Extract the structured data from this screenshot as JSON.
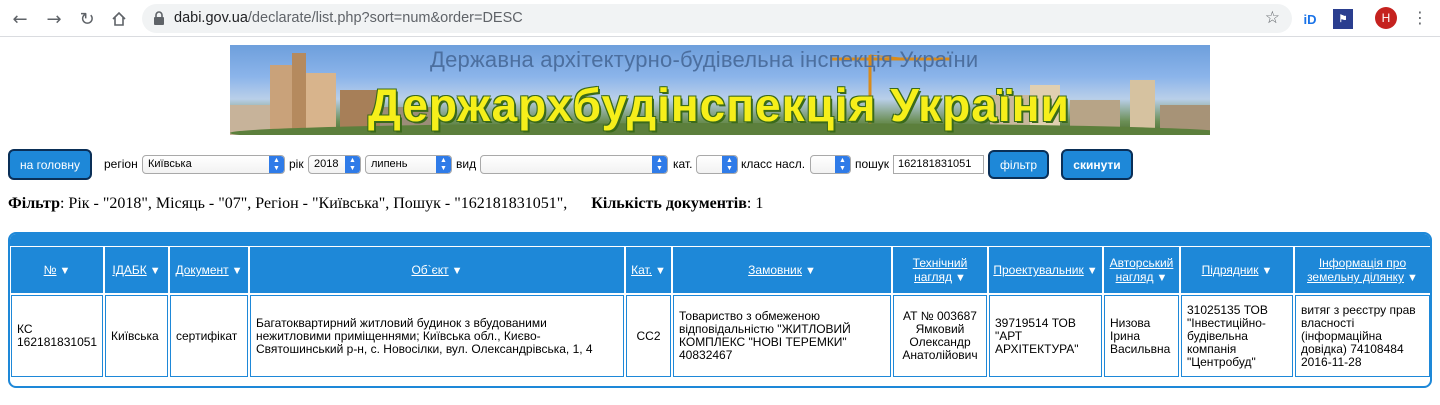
{
  "browser": {
    "url_host": "dabi.gov.ua",
    "url_path": "/declarate/list.php?sort=num&order=DESC",
    "avatar_letter": "H"
  },
  "banner": {
    "subtitle": "Державна архітектурно-будівельна інспекція України",
    "title": "Держархбудінспекція України"
  },
  "controls": {
    "home_button": "на головну",
    "region_label": "регіон",
    "region_value": "Київська",
    "year_label": "рік",
    "year_value": "2018",
    "month_value": "липень",
    "type_label": "вид",
    "type_value": "",
    "cat_label": "кат.",
    "cat_value": "",
    "class_label": "класс насл.",
    "class_value": "",
    "search_label": "пошук",
    "search_value": "162181831051",
    "filter_button": "фільтр",
    "reset_button": "скинути"
  },
  "filter_line": {
    "filter_label": "Фільтр",
    "filter_text": ": Рік - \"2018\", Місяць - \"07\", Регіон - \"Київська\", Пошук - \"162181831051\",",
    "count_label": "Кількість документів",
    "count_text": ": 1"
  },
  "table": {
    "headers": [
      {
        "l1": "№",
        "l2": ""
      },
      {
        "l1": "ІДАБК",
        "l2": ""
      },
      {
        "l1": "Документ",
        "l2": ""
      },
      {
        "l1": "Об`єкт",
        "l2": ""
      },
      {
        "l1": "Кат.",
        "l2": ""
      },
      {
        "l1": "Замовник",
        "l2": ""
      },
      {
        "l1": "Технічний",
        "l2": "нагляд"
      },
      {
        "l1": "Проектувальник",
        "l2": ""
      },
      {
        "l1": "Авторський",
        "l2": "нагляд"
      },
      {
        "l1": "Підрядник",
        "l2": ""
      },
      {
        "l1": "Інформація про",
        "l2": "земельну ділянку"
      }
    ],
    "row": [
      "КС 162181831051",
      "Київська",
      "сертифікат",
      "Багатоквартирний житловий будинок з вбудованими нежитловими приміщеннями; Київська обл., Києво-Святошинський р-н, с. Новосілки, вул. Олександрівська, 1, 4",
      "СС2",
      "Товариство з обмеженою відповідальністю \"ЖИТЛОВИЙ КОМПЛЕКС \"НОВІ ТЕРЕМКИ\" 40832467",
      "АТ № 003687 Ямковий Олександр Анатолійович",
      "39719514 ТОВ \"АРТ АРХІТЕКТУРА\"",
      "Низова Ірина Васильвна",
      "31025135 ТОВ \"Інвестиційно-будівельна компанія \"Центробуд\"",
      "витяг з реєстру прав власності (інформаційна довідка) 74108484 2016-11-28"
    ]
  }
}
